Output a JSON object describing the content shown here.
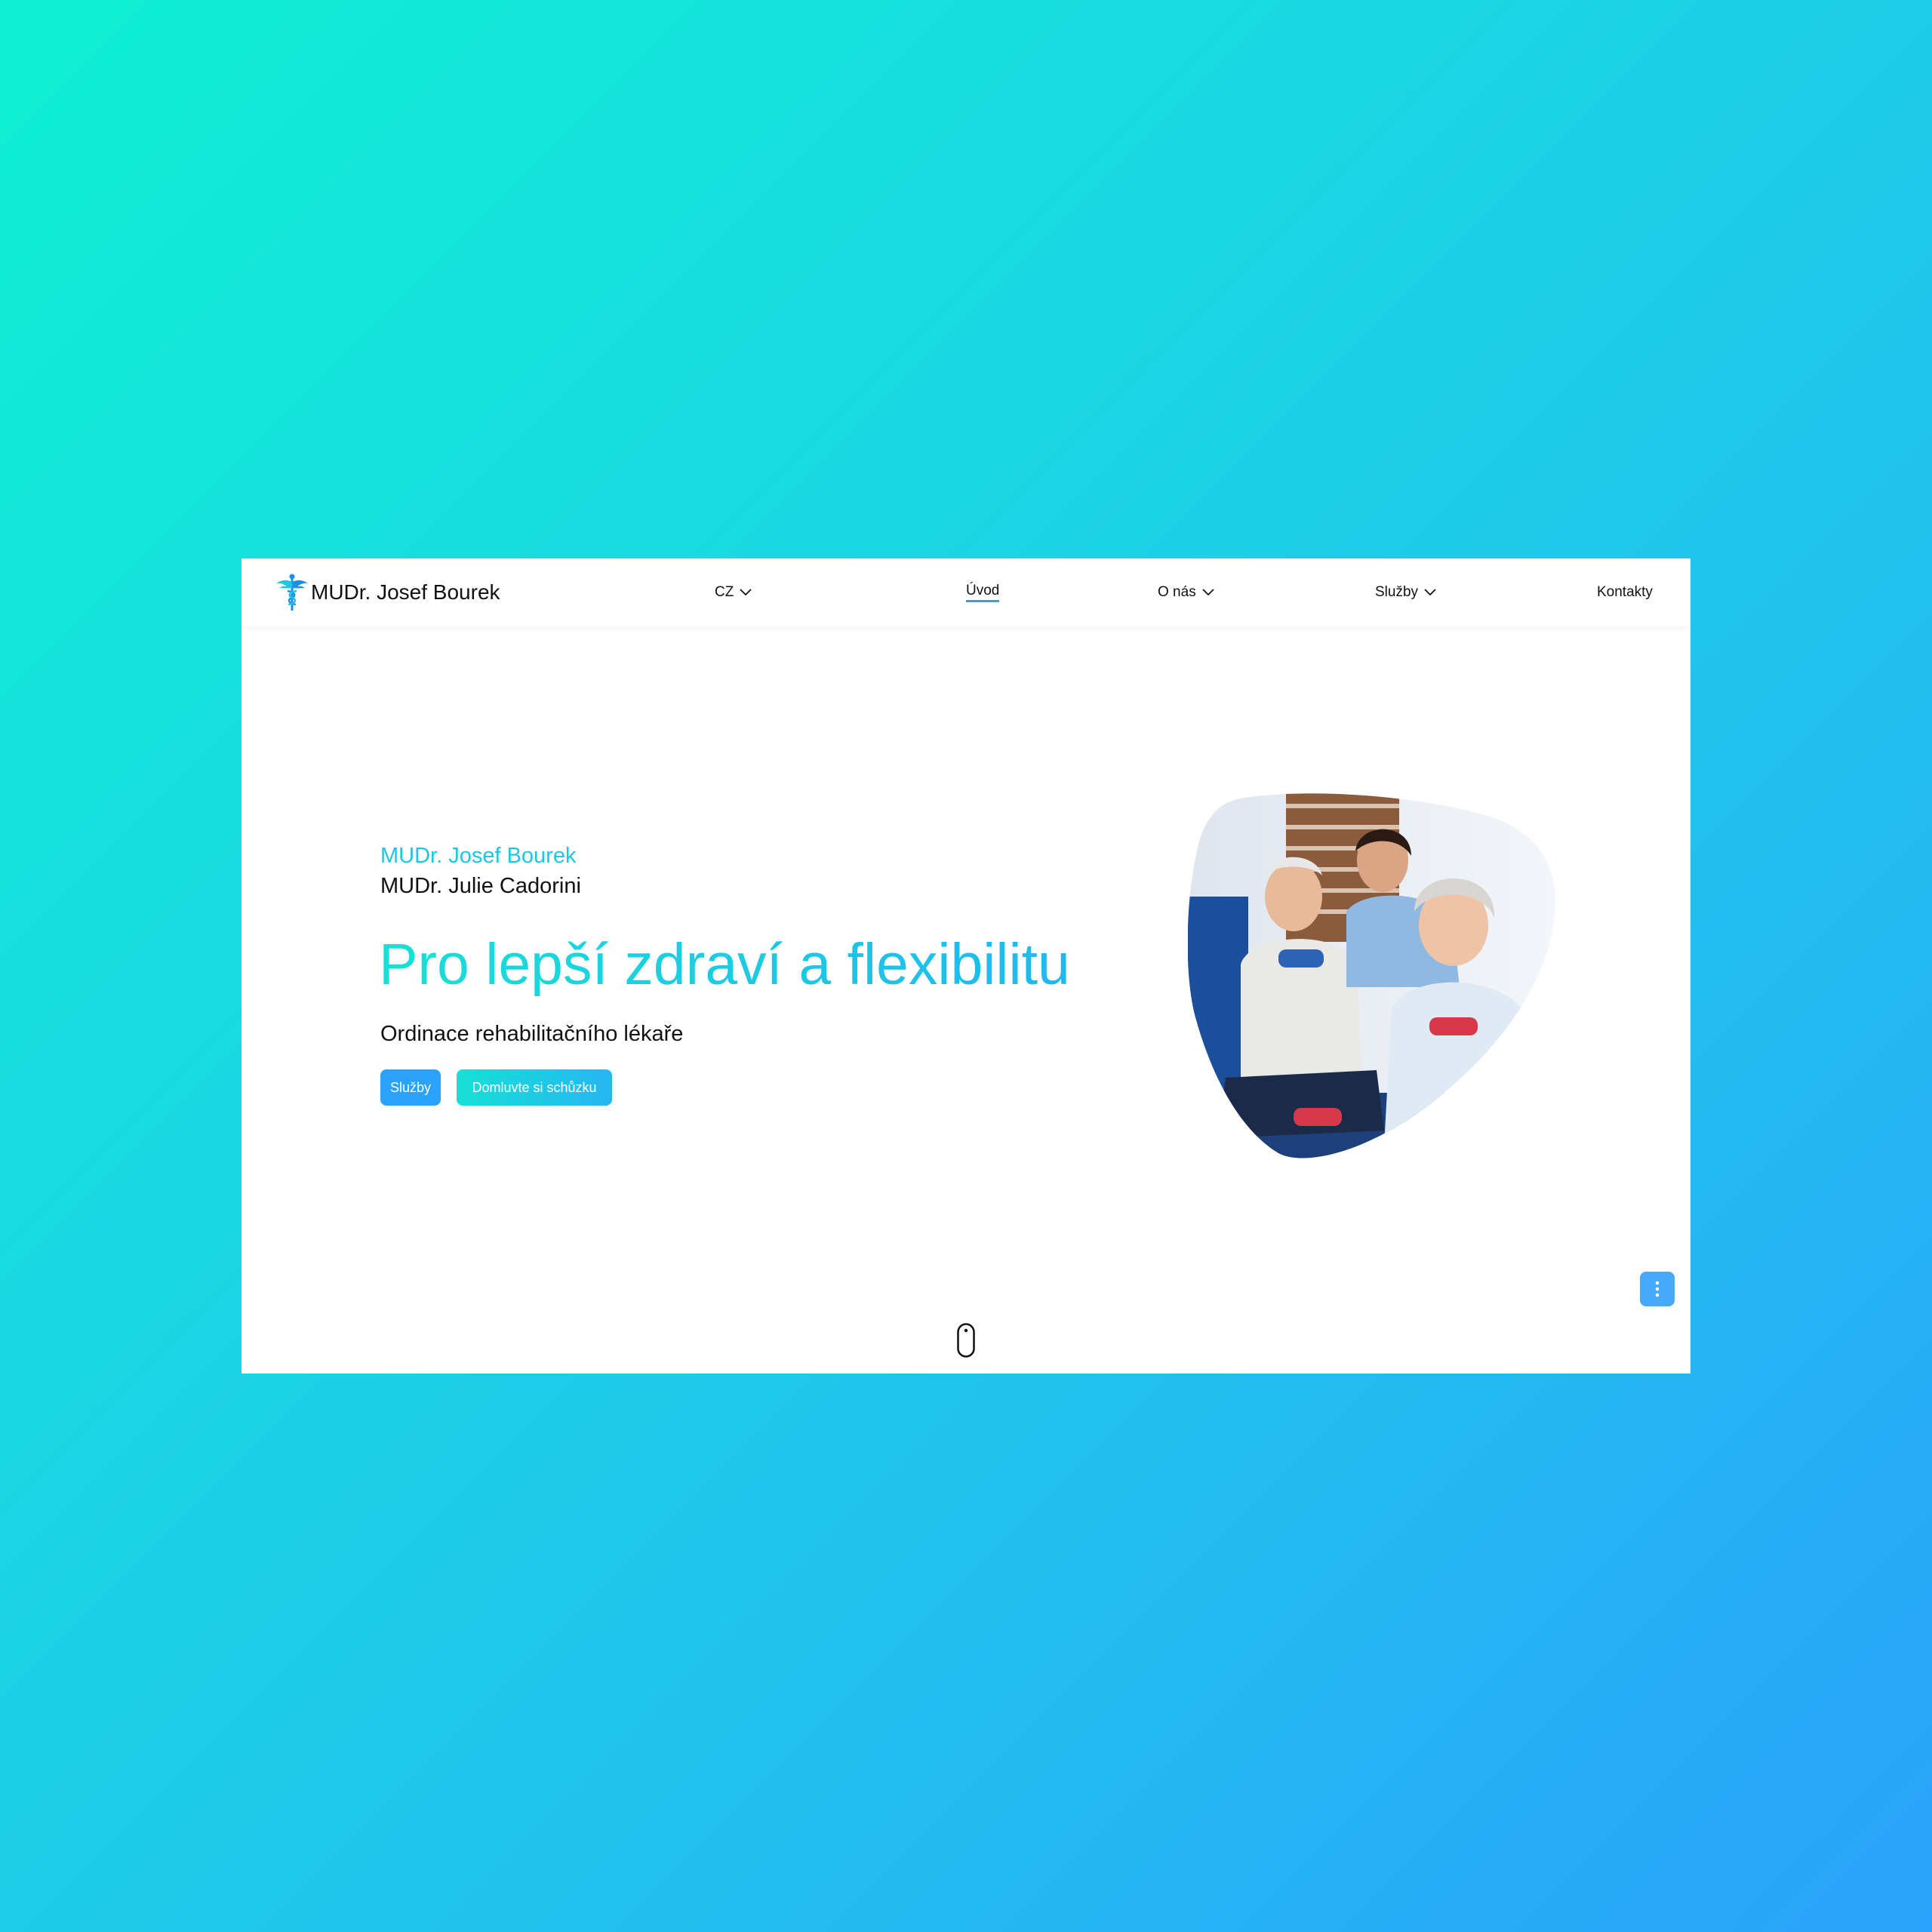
{
  "brand": {
    "name": "MUDr. Josef Bourek",
    "logo_icon": "caduceus-icon"
  },
  "nav": {
    "language": "CZ",
    "items": [
      "Úvod",
      "O nás",
      "Služby",
      "Kontakty"
    ],
    "active": "Úvod"
  },
  "hero": {
    "doctor_primary": "MUDr. Josef Bourek",
    "doctor_secondary": "MUDr. Julie Cadorini",
    "title": "Pro lepší zdraví a flexibilitu",
    "subtitle": "Ordinace rehabilitačního lékaře",
    "buttons": {
      "services": "Služby",
      "appointment": "Domluvte si schůzku"
    }
  },
  "colors": {
    "accent_blue": "#2ba2fb",
    "accent_teal": "#17e0d6",
    "background_gradient_start": "#0ff0d3",
    "background_gradient_end": "#2ba2fb"
  },
  "icons": {
    "fab": "more-vertical-icon",
    "scroll": "mouse-scroll-icon",
    "dropdown": "chevron-down-icon"
  }
}
